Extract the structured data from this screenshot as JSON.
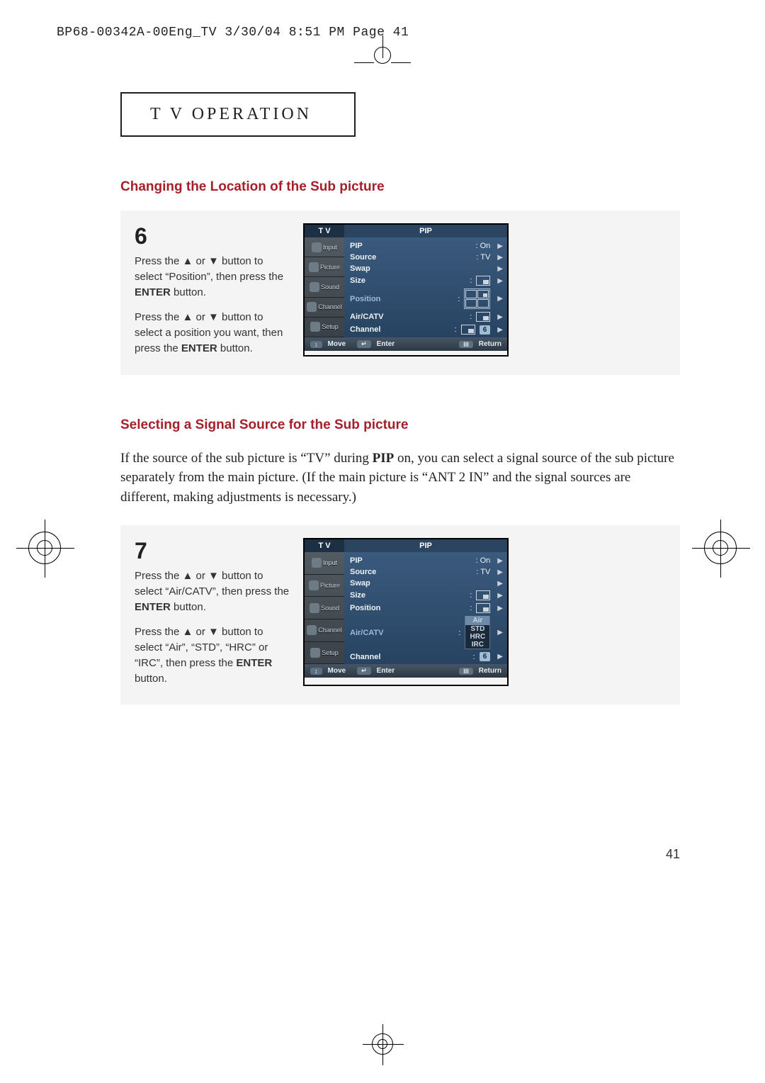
{
  "print_header": "BP68-00342A-00Eng_TV  3/30/04  8:51 PM  Page 41",
  "section_title_a": "T V  ",
  "section_title_b": "O",
  "section_title_c": "PERATION",
  "heading1": "Changing the Location of the Sub picture",
  "step6": {
    "num": "6",
    "p1_a": "Press the ▲ or ▼ button to select “Position”, then press the ",
    "p1_b": "ENTER",
    "p1_c": " button.",
    "p2_a": "Press the ▲ or ▼ button to select a position you want, then press the ",
    "p2_b": "ENTER",
    "p2_c": " button."
  },
  "menu6": {
    "hl": "T V",
    "hr": "PIP",
    "side": [
      "Input",
      "Picture",
      "Sound",
      "Channel",
      "Setup"
    ],
    "rows": {
      "pip": "PIP",
      "pip_v": ":  On",
      "source": "Source",
      "source_v": ":  TV",
      "swap": "Swap",
      "size": "Size",
      "position": "Position",
      "aircatv": "Air/CATV",
      "channel": "Channel",
      "channel_v": "6"
    },
    "bottom": {
      "move": "Move",
      "enter": "Enter",
      "ret": "Return"
    }
  },
  "heading2": "Selecting a Signal Source for the Sub picture",
  "body2_a": "If the source of the sub picture is “TV” during ",
  "body2_b": "PIP",
  "body2_c": " on, you can select a signal source of the sub picture separately from the main picture. (If the main picture is “ANT 2 IN” and the signal sources are different, making adjustments is necessary.)",
  "step7": {
    "num": "7",
    "p1_a": "Press the ▲ or ▼ button to select “Air/CATV”, then press the ",
    "p1_b": "ENTER",
    "p1_c": " button.",
    "p2_a": "Press the ▲ or ▼ button to select “Air”, “STD”, “HRC” or “IRC”,  then press the ",
    "p2_b": "ENTER",
    "p2_c": " button."
  },
  "menu7": {
    "hl": "T V",
    "hr": "PIP",
    "side": [
      "Input",
      "Picture",
      "Sound",
      "Channel",
      "Setup"
    ],
    "rows": {
      "pip": "PIP",
      "pip_v": ":  On",
      "source": "Source",
      "source_v": ":  TV",
      "swap": "Swap",
      "size": "Size",
      "position": "Position",
      "aircatv": "Air/CATV",
      "aircatv_pop": {
        "opt1": "Air",
        "opt2": "STD",
        "opt3": "HRC",
        "opt4": "IRC"
      },
      "channel": "Channel",
      "channel_v": "6"
    },
    "bottom": {
      "move": "Move",
      "enter": "Enter",
      "ret": "Return"
    }
  },
  "page_number": "41"
}
